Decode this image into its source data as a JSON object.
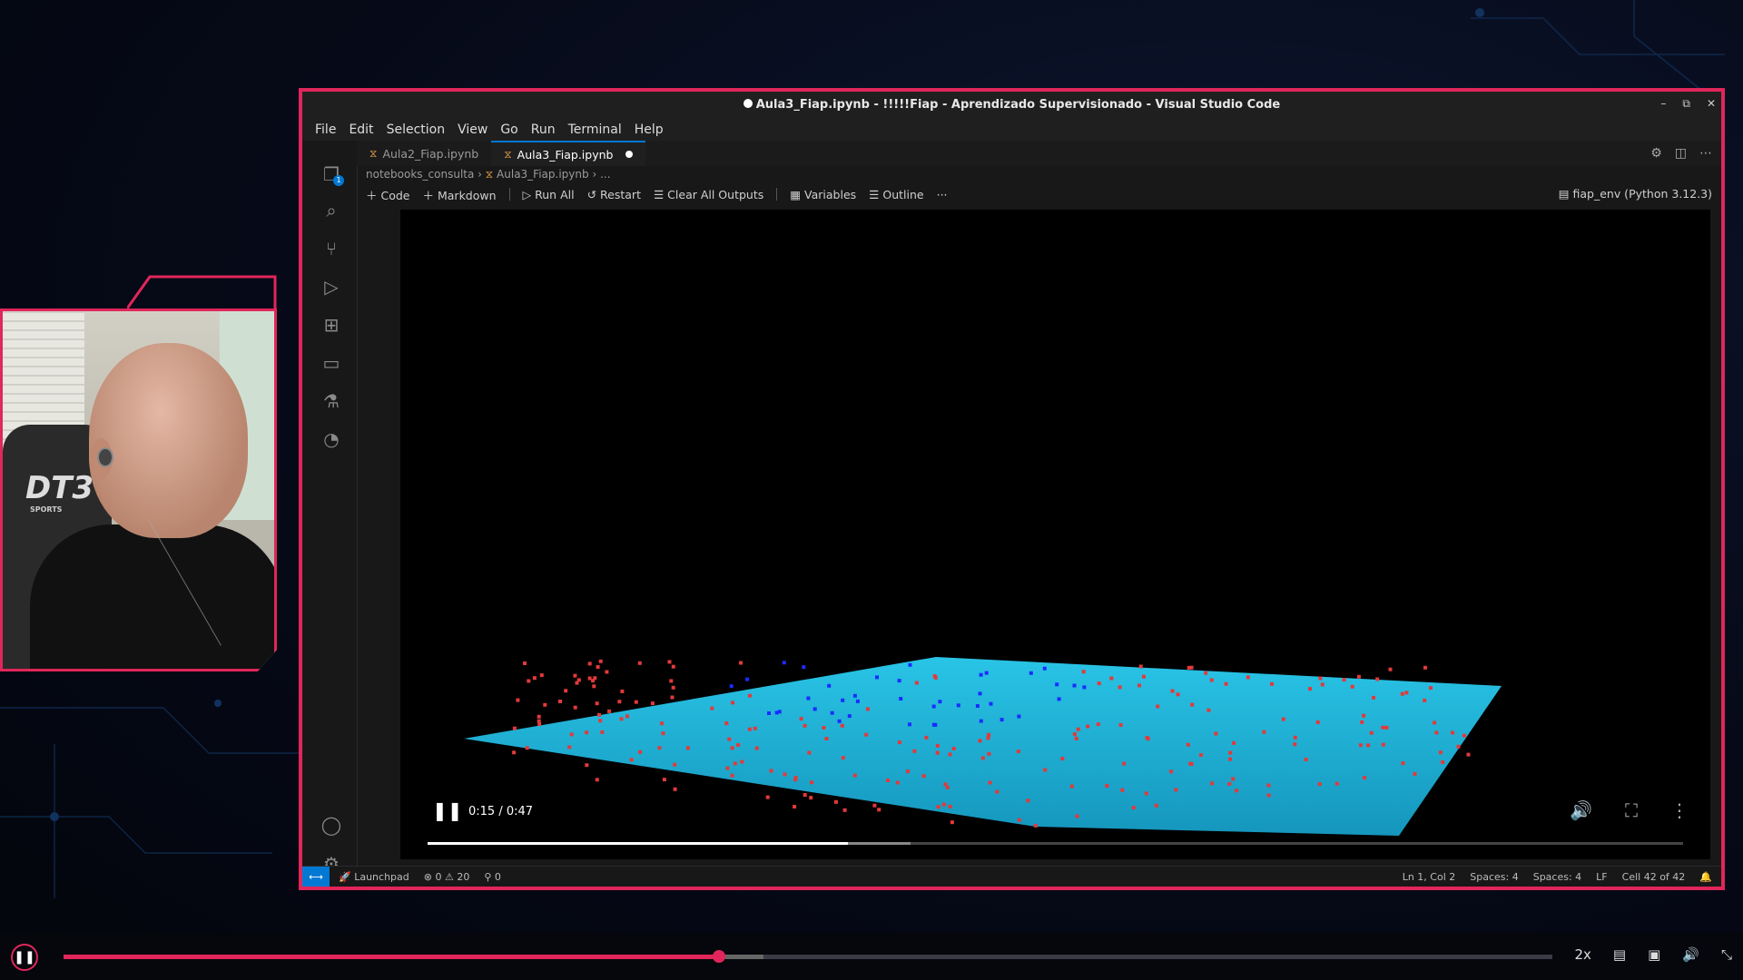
{
  "window": {
    "title": "Aula3_Fiap.ipynb - !!!!!Fiap - Aprendizado Supervisionado - Visual Studio Code",
    "minimize": "–",
    "maximize": "⧉",
    "close": "✕"
  },
  "menu": [
    "File",
    "Edit",
    "Selection",
    "View",
    "Go",
    "Run",
    "Terminal",
    "Help"
  ],
  "activity": {
    "explorer_badge": "1"
  },
  "tabs": [
    {
      "label": "Aula2_Fiap.ipynb"
    },
    {
      "label": "Aula3_Fiap.ipynb"
    }
  ],
  "breadcrumb": {
    "folder": "notebooks_consulta",
    "file": "Aula3_Fiap.ipynb",
    "more": "..."
  },
  "toolbar": {
    "code": "Code",
    "markdown": "Markdown",
    "run_all": "Run All",
    "restart": "Restart",
    "clear": "Clear All Outputs",
    "variables": "Variables",
    "outline": "Outline",
    "more": "···"
  },
  "kernel": "fiap_env (Python 3.12.3)",
  "video": {
    "time": "0:15 / 0:47",
    "progress": 0.335,
    "buffered_to": 0.385
  },
  "status": {
    "launchpad": "Launchpad",
    "errors": "0",
    "warnings": "20",
    "ports": "0",
    "position": "Ln 1, Col 2",
    "spaces1": "Spaces: 4",
    "spaces2": "Spaces: 4",
    "eol": "LF",
    "cell": "Cell 42 of 42"
  },
  "webcam": {
    "chair_brand": "DT3",
    "chair_sub": "SPORTS"
  },
  "player": {
    "progress": 0.44,
    "buffered_to": 0.47,
    "speed": "2x"
  },
  "colors": {
    "accent": "#e0265a",
    "vscode_blue": "#0078d4",
    "plane": "#1fb4d8"
  }
}
